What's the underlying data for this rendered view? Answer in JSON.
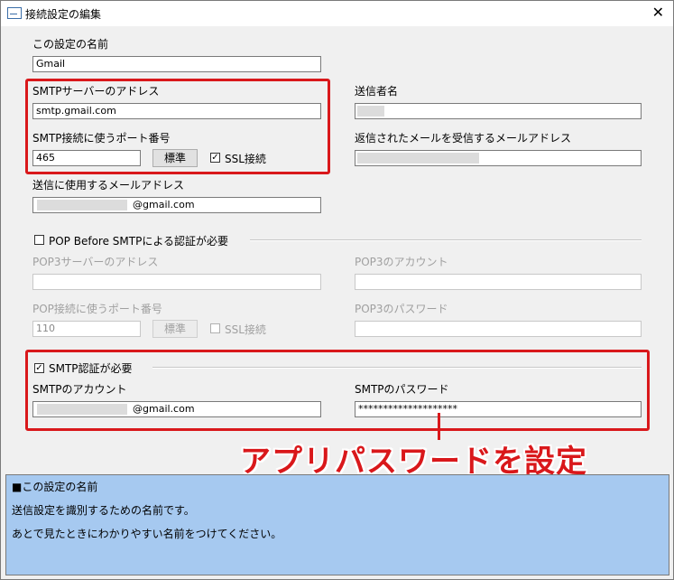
{
  "window": {
    "title": "接続設定の編集",
    "close_glyph": "✕"
  },
  "fields": {
    "setting_name": {
      "label": "この設定の名前",
      "value": "Gmail"
    },
    "smtp_server": {
      "label": "SMTPサーバーのアドレス",
      "value": "smtp.gmail.com"
    },
    "smtp_port": {
      "label": "SMTP接続に使うポート番号",
      "value": "465",
      "default_button": "標準",
      "ssl_label": "SSL接続",
      "ssl_checked": "✓"
    },
    "sender_email": {
      "label": "送信に使用するメールアドレス",
      "value": "@gmail.com"
    },
    "sender_name": {
      "label": "送信者名",
      "value": ""
    },
    "reply_to": {
      "label": "返信されたメールを受信するメールアドレス",
      "value": ""
    }
  },
  "pop_before_smtp": {
    "label": "POP Before SMTPによる認証が必要",
    "pop3_server": {
      "label": "POP3サーバーのアドレス",
      "value": ""
    },
    "pop3_account": {
      "label": "POP3のアカウント",
      "value": ""
    },
    "pop3_port": {
      "label": "POP接続に使うポート番号",
      "value": "110",
      "default_button": "標準",
      "ssl_label": "SSL接続"
    },
    "pop3_password": {
      "label": "POP3のパスワード",
      "value": ""
    }
  },
  "smtp_auth": {
    "label": "SMTP認証が必要",
    "checked": "✓",
    "account": {
      "label": "SMTPのアカウント",
      "value": "@gmail.com"
    },
    "password": {
      "label": "SMTPのパスワード",
      "value": "********************"
    }
  },
  "callout": "アプリパスワードを設定",
  "help": {
    "heading": "■この設定の名前",
    "line1": "送信設定を識別するための名前です。",
    "line2": "あとで見たときにわかりやすい名前をつけてください。"
  },
  "colors": {
    "highlight": "#d9181b",
    "help_bg": "#a6c9f0"
  }
}
